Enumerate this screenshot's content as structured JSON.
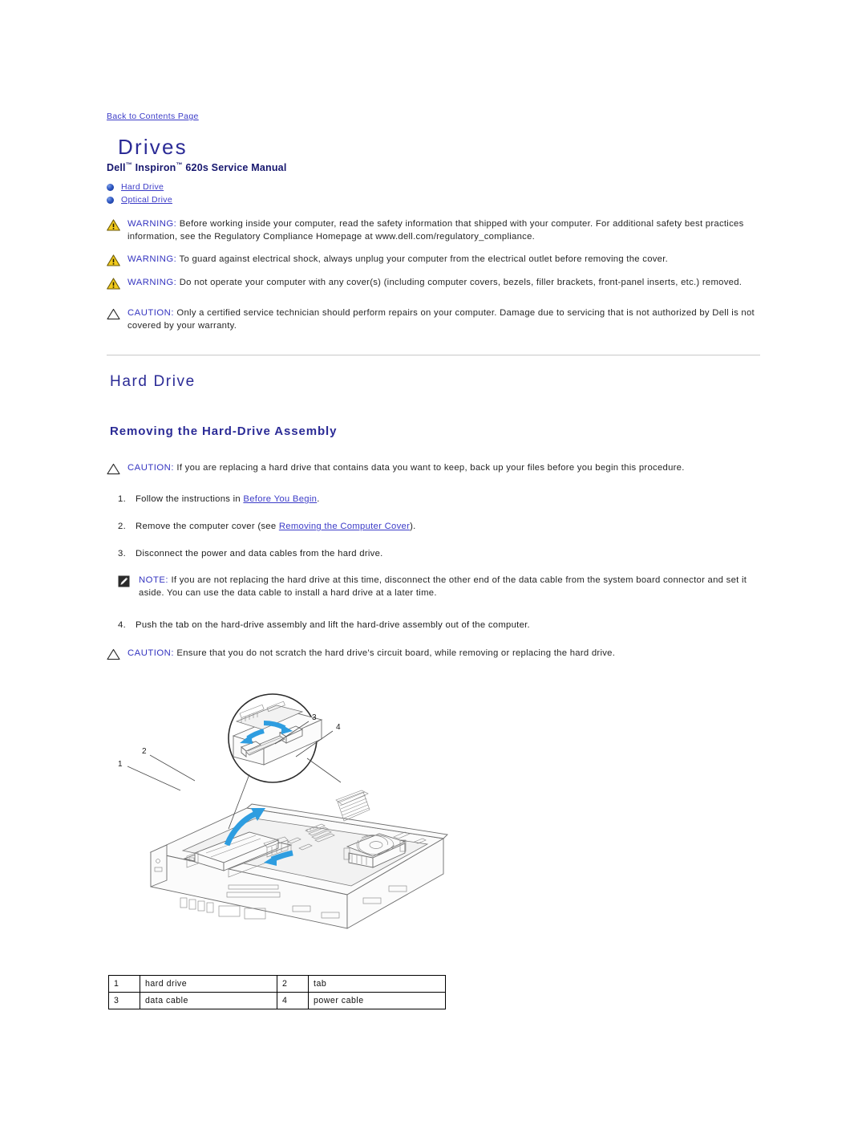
{
  "nav": {
    "back_link": "Back to Contents Page"
  },
  "header": {
    "title": "Drives",
    "subtitle_prefix": "Dell",
    "subtitle_tm1": "™",
    "subtitle_mid": " Inspiron",
    "subtitle_tm2": "™",
    "subtitle_suffix": " 620s Service Manual"
  },
  "toc": {
    "items": [
      {
        "label": "Hard Drive"
      },
      {
        "label": "Optical Drive"
      }
    ]
  },
  "admonitions": [
    {
      "type": "warning",
      "label": "WARNING:",
      "text": " Before working inside your computer, read the safety information that shipped with your computer. For additional safety best practices information, see the Regulatory Compliance Homepage at www.dell.com/regulatory_compliance."
    },
    {
      "type": "warning",
      "label": "WARNING:",
      "text": " To guard against electrical shock, always unplug your computer from the electrical outlet before removing the cover."
    },
    {
      "type": "warning",
      "label": "WARNING:",
      "text": " Do not operate your computer with any cover(s) (including computer covers, bezels, filler brackets, front-panel inserts, etc.) removed."
    },
    {
      "type": "caution",
      "label": "CAUTION:",
      "text": " Only a certified service technician should perform repairs on your computer. Damage due to servicing that is not authorized by Dell is not covered by your warranty."
    }
  ],
  "section": {
    "heading": "Hard Drive",
    "subheading": "Removing the Hard-Drive Assembly",
    "caution_top": {
      "label": "CAUTION:",
      "text": " If you are replacing a hard drive that contains data you want to keep, back up your files before you begin this procedure."
    },
    "steps": [
      {
        "num": "1.",
        "pre": "Follow the instructions in ",
        "link": "Before You Begin",
        "post": "."
      },
      {
        "num": "2.",
        "pre": "Remove the computer cover (see ",
        "link": "Removing the Computer Cover",
        "post": ")."
      },
      {
        "num": "3.",
        "pre": "Disconnect the power and data cables from the hard drive.",
        "link": "",
        "post": ""
      },
      {
        "num": "4.",
        "pre": "Push the tab on the hard-drive assembly and lift the hard-drive assembly out of the computer.",
        "link": "",
        "post": ""
      }
    ],
    "note": {
      "label": "NOTE:",
      "text": " If you are not replacing the hard drive at this time, disconnect the other end of the data cable from the system board connector and set it aside. You can use the data cable to install a hard drive at a later time."
    },
    "caution_bottom": {
      "label": "CAUTION:",
      "text": " Ensure that you do not scratch the hard drive's circuit board, while removing or replacing the hard drive."
    }
  },
  "figure": {
    "callouts": [
      "1",
      "2",
      "3",
      "4"
    ]
  },
  "legend": {
    "rows": [
      {
        "n1": "1",
        "l1": "hard drive",
        "n2": "2",
        "l2": "tab"
      },
      {
        "n1": "3",
        "l1": "data cable",
        "n2": "4",
        "l2": "power cable"
      }
    ]
  },
  "colors": {
    "link": "#3c3cc8",
    "heading": "#2b2b96",
    "warning_yellow": "#f2cb1d",
    "arrow_blue": "#2e9de0"
  }
}
